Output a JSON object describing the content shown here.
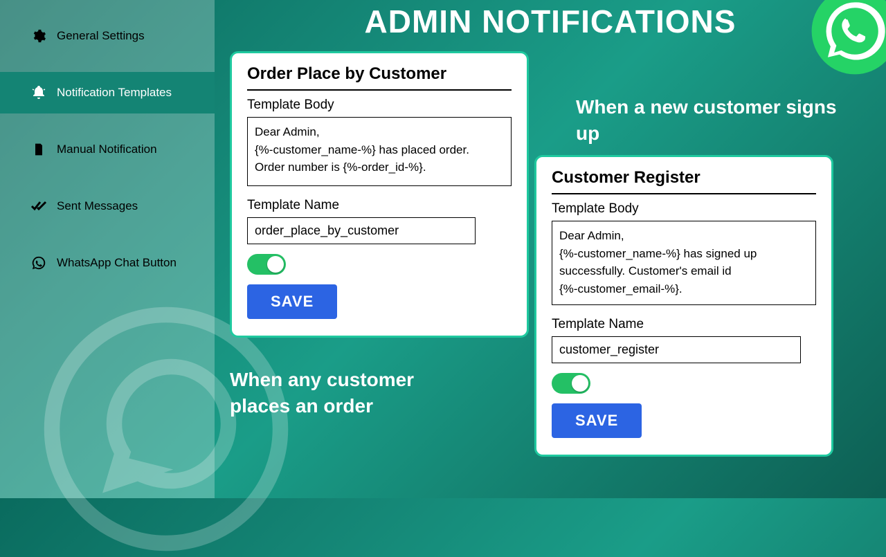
{
  "page_title": "ADMIN NOTIFICATIONS",
  "sidebar": {
    "items": [
      {
        "label": "General Settings",
        "icon": "gear-icon"
      },
      {
        "label": "Notification Templates",
        "icon": "bell-icon"
      },
      {
        "label": "Manual Notification",
        "icon": "document-icon"
      },
      {
        "label": "Sent Messages",
        "icon": "double-check-icon"
      },
      {
        "label": "WhatsApp Chat Button",
        "icon": "whatsapp-icon"
      }
    ],
    "active_index": 1
  },
  "captions": {
    "left": "When any customer places an order",
    "right": "When a new customer signs up"
  },
  "card_order": {
    "title": "Order Place by Customer",
    "body_label": "Template Body",
    "body_value": "Dear Admin,\n{%-customer_name-%} has placed order.\nOrder number is {%-order_id-%}.",
    "name_label": "Template Name",
    "name_value": "order_place_by_customer",
    "toggle_on": true,
    "save_label": "SAVE"
  },
  "card_register": {
    "title": "Customer Register",
    "body_label": "Template Body",
    "body_value": "Dear Admin,\n{%-customer_name-%} has signed up successfully. Customer's email id\n{%-customer_email-%}.",
    "name_label": "Template Name",
    "name_value": "customer_register",
    "toggle_on": true,
    "save_label": "SAVE"
  },
  "colors": {
    "accent": "#1fc99f",
    "button": "#2c64e3",
    "toggle": "#24c065"
  }
}
